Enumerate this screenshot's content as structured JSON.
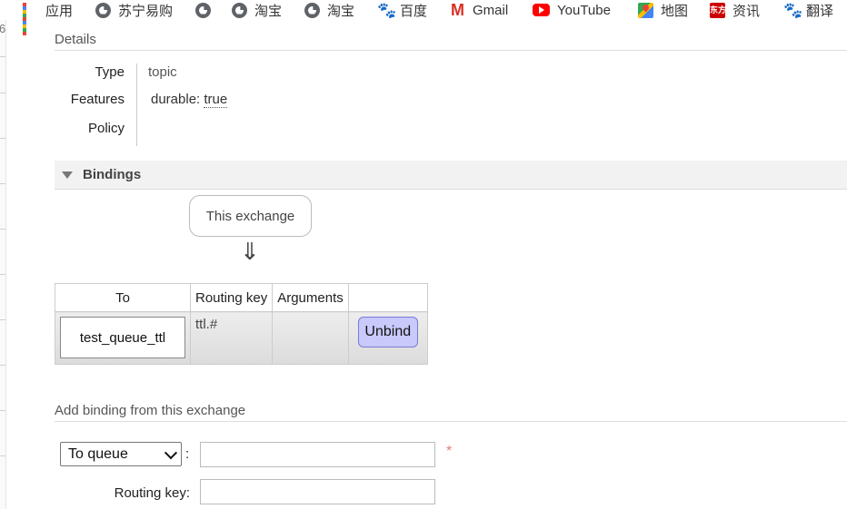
{
  "bookmarks": [
    {
      "label": "应用",
      "icon": "apps-grid-icon"
    },
    {
      "label": "苏宁易购",
      "icon": "globe-icon"
    },
    {
      "label": "",
      "icon": "globe-icon"
    },
    {
      "label": "淘宝",
      "icon": "globe-icon"
    },
    {
      "label": "淘宝",
      "icon": "globe-icon"
    },
    {
      "label": "百度",
      "icon": "baidu-paw-icon"
    },
    {
      "label": "Gmail",
      "icon": "gmail-icon"
    },
    {
      "label": "YouTube",
      "icon": "youtube-icon"
    },
    {
      "label": "地图",
      "icon": "maps-icon"
    },
    {
      "label": "资讯",
      "icon": "dongfang-icon",
      "icon_text": "东方"
    },
    {
      "label": "翻译",
      "icon": "baidu-paw-icon"
    }
  ],
  "left_strip": {
    "marker": "6"
  },
  "details": {
    "title": "Details",
    "type_label": "Type",
    "type_value": "topic",
    "features_label": "Features",
    "features_key": "durable:",
    "features_value": "true",
    "policy_label": "Policy"
  },
  "bindings": {
    "title": "Bindings",
    "source_label": "This exchange",
    "arrow": "⇓",
    "columns": [
      "To",
      "Routing key",
      "Arguments",
      ""
    ],
    "rows": [
      {
        "to": "test_queue_ttl",
        "routing_key": "ttl.#",
        "arguments": "",
        "action": "Unbind"
      }
    ]
  },
  "add_binding": {
    "title": "Add binding from this exchange",
    "destination_type": "To queue",
    "colon": ":",
    "required_mark": "*",
    "destination_value": "",
    "routing_key_label": "Routing key:",
    "routing_key_value": ""
  },
  "colors": {
    "unbind_bg": "#c9c9fb",
    "unbind_border": "#7a7ad6",
    "required": "#e87a7a",
    "section_bar": "#f2f2f2"
  }
}
